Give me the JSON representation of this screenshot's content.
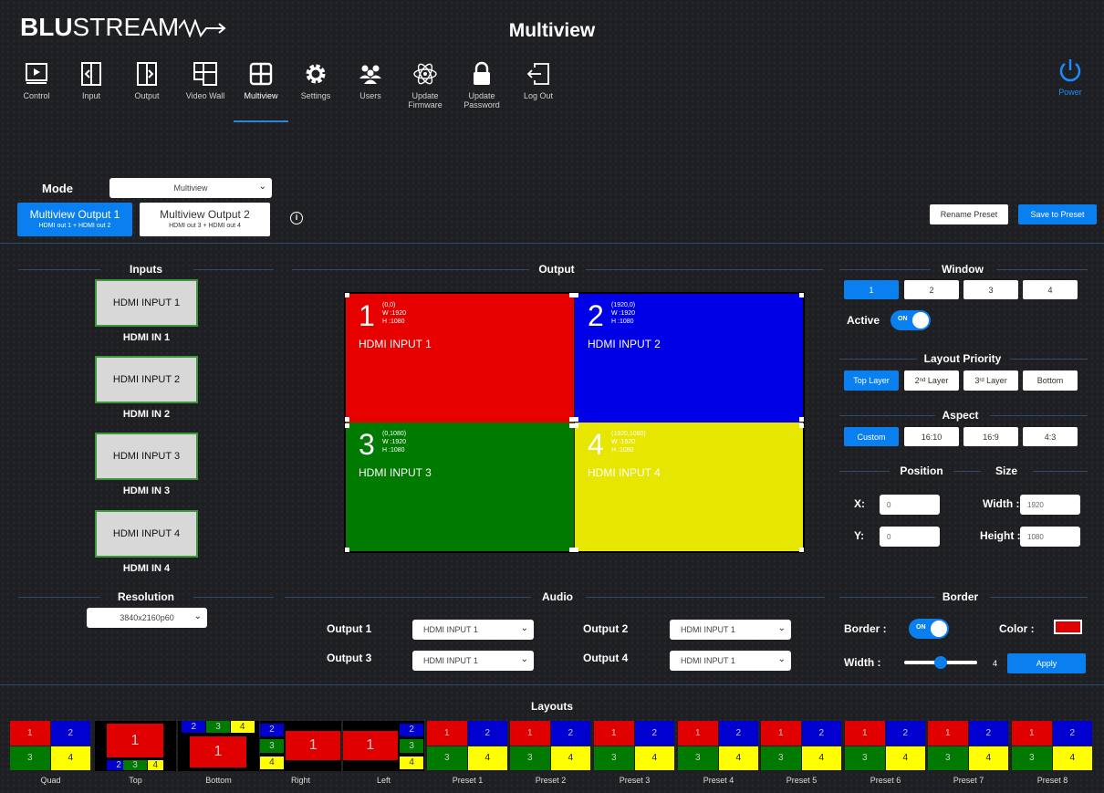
{
  "header": {
    "logo_bold": "BLU",
    "logo_light": "STREAM",
    "page_title": "Multiview",
    "power_label": "Power"
  },
  "nav": [
    {
      "label": "Control",
      "icon": "play-icon"
    },
    {
      "label": "Input",
      "icon": "input-icon"
    },
    {
      "label": "Output",
      "icon": "output-icon"
    },
    {
      "label": "Video Wall",
      "icon": "video-wall-icon"
    },
    {
      "label": "Multiview",
      "icon": "multiview-icon"
    },
    {
      "label": "Settings",
      "icon": "gear-icon"
    },
    {
      "label": "Users",
      "icon": "users-icon"
    },
    {
      "label": "Update\nFirmware",
      "icon": "atom-icon"
    },
    {
      "label": "Update\nPassword",
      "icon": "lock-icon"
    },
    {
      "label": "Log Out",
      "icon": "logout-icon"
    }
  ],
  "mode": {
    "label": "Mode",
    "value": "Multiview"
  },
  "outputs": [
    {
      "title": "Multiview Output 1",
      "sub": "HDMI out 1 + HDMI out 2",
      "active": true
    },
    {
      "title": "Multiview Output 2",
      "sub": "HDMI out 3 + HDMI out 4",
      "active": false
    }
  ],
  "info_icon": "info-icon",
  "rename_preset": "Rename Preset",
  "save_preset": "Save to Preset",
  "inputs": {
    "title": "Inputs",
    "items": [
      {
        "button": "HDMI INPUT 1",
        "label": "HDMI IN 1"
      },
      {
        "button": "HDMI INPUT 2",
        "label": "HDMI IN 2"
      },
      {
        "button": "HDMI INPUT 3",
        "label": "HDMI IN 3"
      },
      {
        "button": "HDMI INPUT 4",
        "label": "HDMI IN 4"
      }
    ]
  },
  "output": {
    "title": "Output",
    "windows": [
      {
        "num": "1",
        "pos": "(0,0)",
        "w": "W :1920",
        "h": "H :1080",
        "name": "HDMI INPUT 1",
        "color": "#e60000"
      },
      {
        "num": "2",
        "pos": "(1920,0)",
        "w": "W :1920",
        "h": "H :1080",
        "name": "HDMI INPUT 2",
        "color": "#0000e6"
      },
      {
        "num": "3",
        "pos": "(0,1080)",
        "w": "W :1920",
        "h": "H :1080",
        "name": "HDMI INPUT 3",
        "color": "#007a00"
      },
      {
        "num": "4",
        "pos": "(1920,1080)",
        "w": "W :1920",
        "h": "H :1080",
        "name": "HDMI INPUT 4",
        "color": "#e6e600"
      }
    ]
  },
  "window": {
    "title": "Window",
    "buttons": [
      "1",
      "2",
      "3",
      "4"
    ],
    "active_label": "Active",
    "toggle_on": "ON"
  },
  "layout_priority": {
    "title": "Layout Priority",
    "top": "Top Layer",
    "second": "2",
    "second_sup": "nd",
    "second_rest": " Layer",
    "third": "3",
    "third_sup": "rd",
    "third_rest": " Layer",
    "bottom": "Bottom"
  },
  "aspect": {
    "title": "Aspect",
    "options": [
      "Custom",
      "16:10",
      "16:9",
      "4:3"
    ]
  },
  "position": {
    "title": "Position",
    "x_label": "X:",
    "x_value": "0",
    "y_label": "Y:",
    "y_value": "0"
  },
  "size": {
    "title": "Size",
    "width_label": "Width :",
    "width_value": "1920",
    "height_label": "Height :",
    "height_value": "1080"
  },
  "resolution": {
    "title": "Resolution",
    "value": "3840x2160p60"
  },
  "audio": {
    "title": "Audio",
    "rows": [
      {
        "label": "Output 1",
        "value": "HDMI INPUT 1"
      },
      {
        "label": "Output 2",
        "value": "HDMI INPUT 1"
      },
      {
        "label": "Output 3",
        "value": "HDMI INPUT 1"
      },
      {
        "label": "Output 4",
        "value": "HDMI INPUT 1"
      }
    ]
  },
  "border": {
    "title": "Border",
    "border_label": "Border :",
    "toggle_on": "ON",
    "color_label": "Color :",
    "color": "#e00000",
    "width_label": "Width :",
    "width_value": "4",
    "width_level": 0.5,
    "apply": "Apply"
  },
  "layouts": {
    "title": "Layouts",
    "items": [
      "Quad",
      "Top",
      "Bottom",
      "Right",
      "Left",
      "Preset 1",
      "Preset 2",
      "Preset 3",
      "Preset 4",
      "Preset 5",
      "Preset 6",
      "Preset 7",
      "Preset 8"
    ],
    "cell_labels": [
      "1",
      "2",
      "3",
      "4"
    ]
  }
}
